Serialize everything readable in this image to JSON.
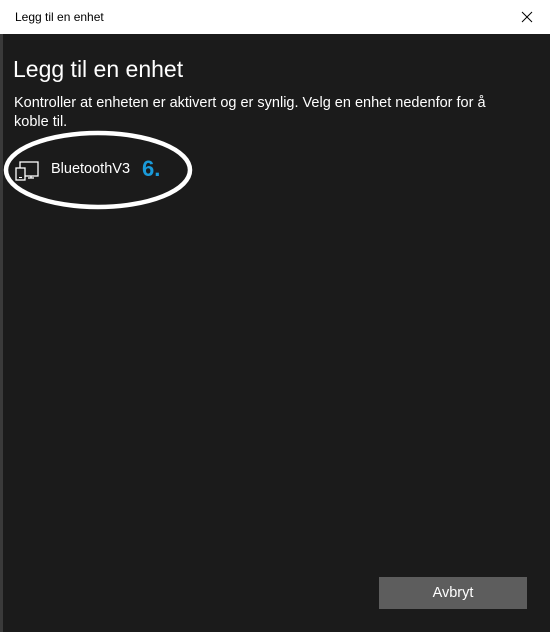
{
  "window": {
    "title": "Legg til en enhet",
    "close_icon": "close-icon"
  },
  "main": {
    "heading": "Legg til en enhet",
    "instructions": "Kontroller at enheten er aktivert og er synlig. Velg en enhet nedenfor for å koble til."
  },
  "devices": [
    {
      "name": "BluetoothV3",
      "icon": "device-icon"
    }
  ],
  "annotation": {
    "step_label": "6.",
    "color": "#1a9ad9"
  },
  "footer": {
    "cancel_label": "Avbryt"
  },
  "colors": {
    "background": "#1b1b1b",
    "titlebar": "#ffffff",
    "button": "#5d5d5d"
  }
}
